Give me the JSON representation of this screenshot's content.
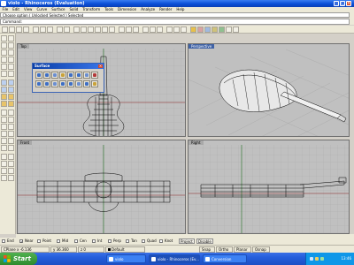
{
  "window": {
    "title": "violo - Rhinoceros (Evaluation)"
  },
  "menu": [
    "File",
    "Edit",
    "View",
    "Curve",
    "Surface",
    "Solid",
    "Transform",
    "Tools",
    "Dimension",
    "Analyze",
    "Render",
    "Help"
  ],
  "command": {
    "history": "Choose option ( Unlocked Selected ) Selected",
    "prompt": "Command:"
  },
  "surface_panel": {
    "title": "Surface"
  },
  "viewports": {
    "top": "Top",
    "perspective": "Perspective",
    "front": "Front",
    "right": "Right"
  },
  "osnap": {
    "items": [
      {
        "label": "End",
        "checked": false
      },
      {
        "label": "Near",
        "checked": true
      },
      {
        "label": "Point",
        "checked": false
      },
      {
        "label": "Mid",
        "checked": false
      },
      {
        "label": "Cen",
        "checked": false
      },
      {
        "label": "Int",
        "checked": false
      },
      {
        "label": "Perp",
        "checked": false
      },
      {
        "label": "Tan",
        "checked": false
      },
      {
        "label": "Quad",
        "checked": false
      },
      {
        "label": "Knot",
        "checked": false
      }
    ],
    "project": "Project",
    "disable": "Disable"
  },
  "status": {
    "cplane": "CPlane x -6.136",
    "y": "y 36.360",
    "z": "z 0",
    "layer": "Default",
    "snap": "Snap",
    "ortho": "Ortho",
    "planar": "Planar",
    "osnap": "Osnap"
  },
  "taskbar": {
    "start": "Start",
    "tasks": [
      "violo",
      "violo - Rhinoceros (Ev...",
      "Conversion"
    ],
    "clock": "13:46"
  }
}
